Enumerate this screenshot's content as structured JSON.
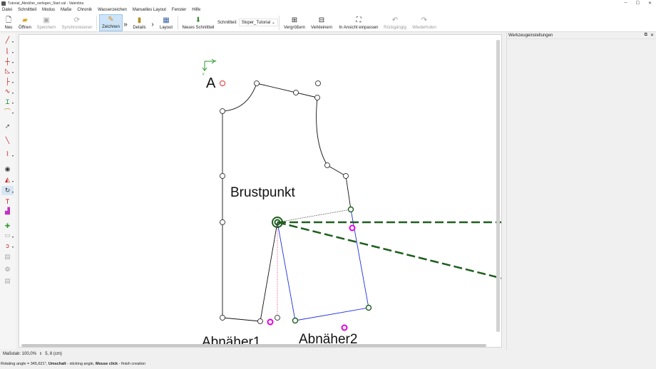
{
  "window": {
    "title": "Tutorial_Abnäher_verlegen_Start.val - Valentina",
    "controls": [
      "─",
      "☐",
      "✕"
    ]
  },
  "menu": [
    "Datei",
    "Schnittteil",
    "Modus",
    "Maße",
    "Chronik",
    "Wasserzeichen",
    "Manuelles Layout",
    "Fenster",
    "Hilfe"
  ],
  "toolbar": {
    "new": "Neu",
    "open": "Öffnen",
    "save": "Speichern",
    "sync": "Synchronisieren",
    "draw": "Zeichnen",
    "details": "Details",
    "layout": "Layout",
    "new_piece": "Neues Schnittteil",
    "piece_label": "Schnittteil:",
    "piece_value": "Sloper_Tutorial",
    "zoom_in": "Vergrößern",
    "zoom_out": "Verkleinern",
    "fit": "In Ansicht einpassen",
    "undo": "Rückgängig",
    "redo": "Wiederholen"
  },
  "panel": {
    "title": "Werkzeugeinstellungen"
  },
  "canvas": {
    "point_a": "A",
    "axis_x": "x",
    "axis_y": "y",
    "label_brustpunkt": "Brustpunkt",
    "label_dart1": "Abnäher1",
    "label_dart2": "Abnäher2"
  },
  "status": {
    "zoom_label": "Maßstab: 100,0%",
    "spin": "⇕",
    "coords": "5, 8 (cm)",
    "hint_prefix": "Rotating angle = 345,621°, ",
    "hint_key1": "Umschalt",
    "hint_mid": " - sticking angle, ",
    "hint_key2": "Mouse click",
    "hint_suffix": " - finish creation"
  },
  "colors": {
    "accent": "#cde3f7",
    "line_dark_green": "#1f5f1f",
    "point_magenta": "#e000e0",
    "point_red": "#e03030",
    "line_blue": "#2030e0"
  }
}
